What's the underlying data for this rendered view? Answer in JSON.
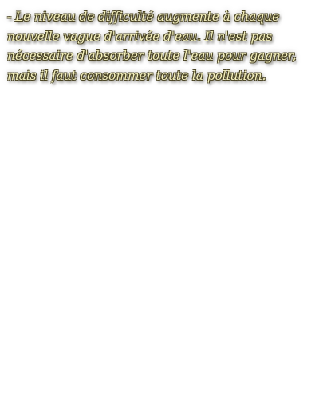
{
  "tip": {
    "text": "- Le niveau de difficulté augmente à chaque nouvelle vague d'arrivée d'eau. Il n'est pas nécessaire d'absorber toute l'eau pour gagner, mais il faut consommer toute la pollution."
  }
}
